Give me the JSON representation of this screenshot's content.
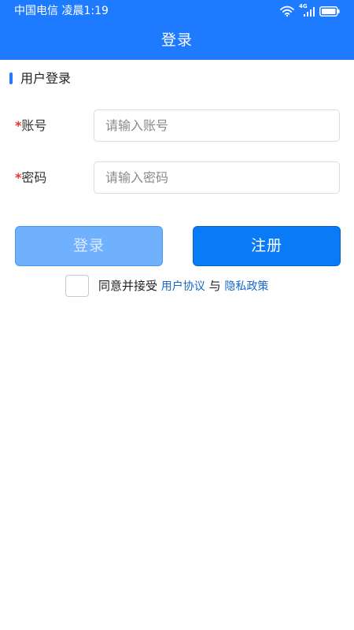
{
  "status_bar": {
    "carrier_time": "中国电信 凌晨1:19",
    "network_type": "4G",
    "icons": [
      "wifi-icon",
      "signal-icon",
      "battery-icon"
    ]
  },
  "header": {
    "title": "登录"
  },
  "section": {
    "title": "用户登录"
  },
  "form": {
    "required_mark": "*",
    "account": {
      "label": "账号",
      "placeholder": "请输入账号",
      "value": ""
    },
    "password": {
      "label": "密码",
      "placeholder": "请输入密码",
      "value": ""
    }
  },
  "buttons": {
    "login_label": "登录",
    "register_label": "注册"
  },
  "agreement": {
    "checked": false,
    "prefix": "同意并接受",
    "user_agreement_link": "用户协议",
    "conjunction": "与",
    "privacy_policy_link": "隐私政策"
  },
  "colors": {
    "primary": "#1e7bff",
    "login_button_disabled": "#6fb1fd",
    "register_button": "#0a7bf6",
    "link": "#1667c9",
    "required": "#e8332f"
  }
}
